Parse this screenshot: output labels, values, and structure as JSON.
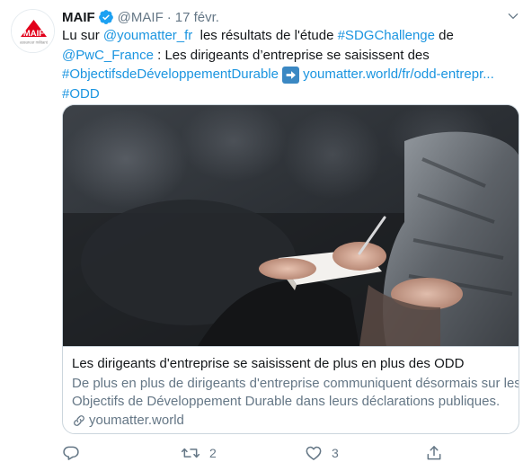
{
  "author": {
    "name": "MAIF",
    "handle": "@MAIF",
    "separator": "·",
    "date": "17 févr.",
    "avatar_logo_text": "MAIF",
    "avatar_tagline": "assureur militant",
    "verified": true
  },
  "tweet": {
    "line1": {
      "prefix": "Lu sur ",
      "mention": "@youmatter_fr",
      "middle": "  les résultats de l'étude ",
      "hashtag": "#SDGChallenge",
      "suffix": " de"
    },
    "line2": {
      "mention": "@PwC_France",
      "text": " : Les dirigeants d’entreprise se saisissent des"
    },
    "line3": {
      "hashtag": "#ObjectifsdeDéveloppementDurable",
      "url": "youmatter.world/fr/odd-entrepr..."
    },
    "line4": {
      "hashtag": "#ODD"
    }
  },
  "card": {
    "title": "Les dirigeants d'entreprise se saisissent de plus en plus des ODD",
    "description_line1": "De plus en plus de dirigeants d'entreprise communiquent désormais sur les",
    "description_line2": "Objectifs de Développement Durable dans leurs déclarations publiques.",
    "domain": "youmatter.world"
  },
  "actions": {
    "reply_count": "",
    "retweet_count": "2",
    "like_count": "3"
  },
  "colors": {
    "link": "#1b95e0",
    "muted": "#657786",
    "text": "#14171a",
    "brand_red": "#e2001a",
    "verified": "#1da1f2"
  },
  "icons": [
    "verified-badge-icon",
    "chevron-down-icon",
    "right-arrow-emoji-icon",
    "link-icon",
    "reply-icon",
    "retweet-icon",
    "like-icon",
    "share-icon"
  ]
}
